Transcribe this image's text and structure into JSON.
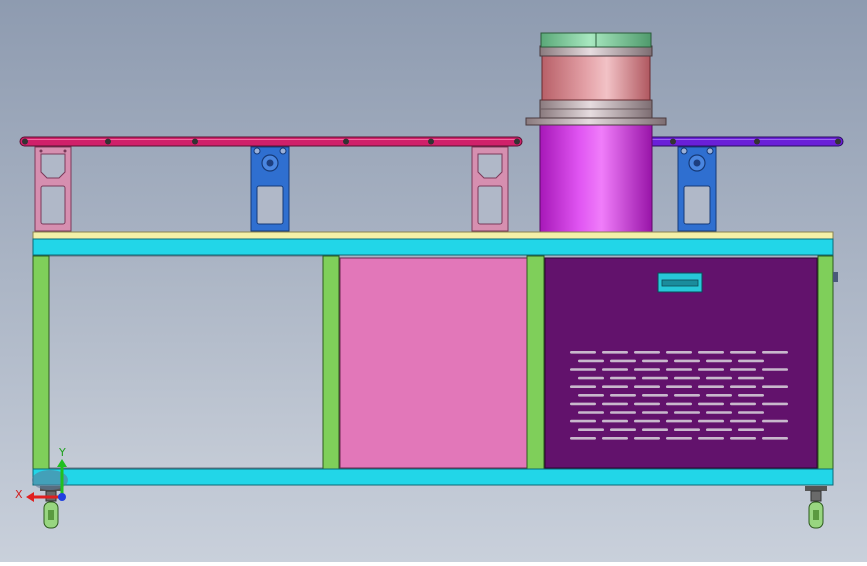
{
  "triad": {
    "x_label": "X",
    "y_label": "Y"
  },
  "colors": {
    "background_top": "#8e9bb0",
    "background_bottom": "#c8cfda",
    "conveyor_left": "#d0206a",
    "conveyor_right": "#6a1fd8",
    "bracket_pink": "#d68fb0",
    "bracket_blue": "#2f6fd0",
    "tabletop": "#f3f0a8",
    "cyan_frame": "#22d6e8",
    "green_frame": "#7fcf5a",
    "pink_panel": "#e277b9",
    "purple_panel": "#62126c",
    "cylinder_purple": "#d63ce8",
    "cylinder_pink": "#d77f86",
    "cylinder_top_green": "#7fd0a0",
    "handle_teal": "#27c8d8",
    "x_axis": "#e02020",
    "y_axis": "#20c020",
    "z_axis": "#2040e0"
  }
}
